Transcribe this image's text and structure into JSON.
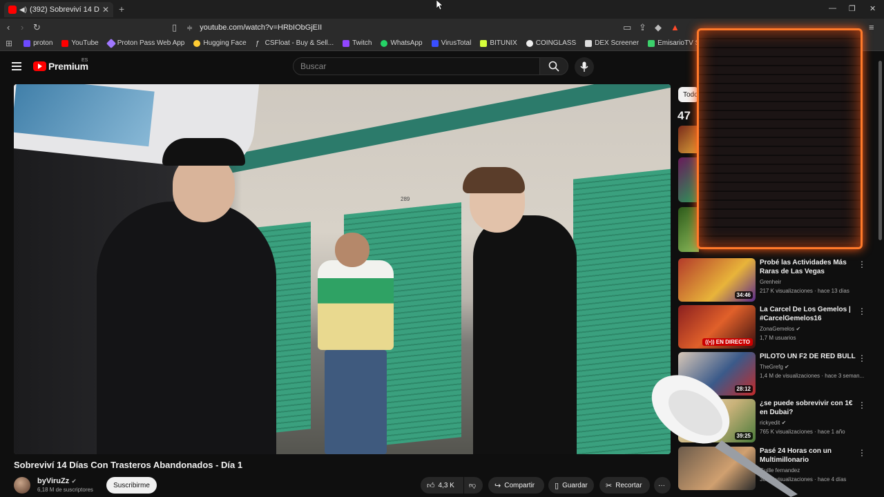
{
  "browser": {
    "tab_title": "(392) Sobreviví 14 Días Con T",
    "new_tab": "+",
    "url": "youtube.com/watch?v=HRbIObGjEII",
    "bookmarks": [
      {
        "label": "proton",
        "color": "#6d4aff"
      },
      {
        "label": "YouTube",
        "color": "#ff0000"
      },
      {
        "label": "Proton Pass Web App",
        "color": "#a078ff"
      },
      {
        "label": "Hugging Face",
        "color": "#ffcc33"
      },
      {
        "label": "CSFloat - Buy & Sell...",
        "color": "#2b2b2b"
      },
      {
        "label": "Twitch",
        "color": "#9146ff"
      },
      {
        "label": "WhatsApp",
        "color": "#25d366"
      },
      {
        "label": "VirusTotal",
        "color": "#394eff"
      },
      {
        "label": "BITUNIX",
        "color": "#d7ff3b"
      },
      {
        "label": "COINGLASS",
        "color": "#222222"
      },
      {
        "label": "DEX Screener",
        "color": "#dddddd"
      },
      {
        "label": "EmisarioTV Stream -...",
        "color": "#3cd16b"
      }
    ]
  },
  "header": {
    "logo_text": "Premium",
    "logo_region": "ES",
    "search_placeholder": "Buscar"
  },
  "video": {
    "title": "Sobreviví 14 Días Con Trasteros Abandonados - Día 1",
    "channel": "byViruZz",
    "subscribers": "6,18 M de suscriptores",
    "subscribe_label": "Suscribirme",
    "likes": "4,3 K",
    "share_label": "Compartir",
    "save_label": "Guardar",
    "clip_label": "Recortar",
    "building_number": "289"
  },
  "sidebar": {
    "chip_label": "Todos",
    "partial_count": "47",
    "recommendations": [
      {
        "title": "Probé las Actividades Más Raras de Las Vegas",
        "channel": "Grenheir",
        "verified": false,
        "meta": "217 K visualizaciones · hace 13 días",
        "duration": "34:46",
        "live": false,
        "thumb": "#b33a2a"
      },
      {
        "title": "La Carcel De Los Gemelos | #CarcelGemelos16",
        "channel": "ZonaGemelos",
        "verified": true,
        "meta": "1,7 M usuarios",
        "duration": "EN DIRECTO",
        "live": true,
        "thumb": "#8a1f1f"
      },
      {
        "title": "PILOTO UN F2 DE RED BULL",
        "channel": "TheGrefg",
        "verified": true,
        "meta": "1,4 M de visualizaciones · hace 3 seman...",
        "duration": "28:12",
        "live": false,
        "thumb": "#3b5a8a"
      },
      {
        "title": "¿se puede sobrevivir con 1€ en Dubai?",
        "channel": "rickyedit",
        "verified": true,
        "meta": "765 K visualizaciones · hace 1 año",
        "duration": "39:25",
        "live": false,
        "thumb": "#c9b27a"
      },
      {
        "title": "Pasé 24 Horas con un Multimillonario",
        "channel": "Guille fernandez",
        "verified": false,
        "meta": "384 K visualizaciones · hace 4 días",
        "duration": "",
        "live": false,
        "thumb": "#6b5a4a"
      }
    ]
  }
}
